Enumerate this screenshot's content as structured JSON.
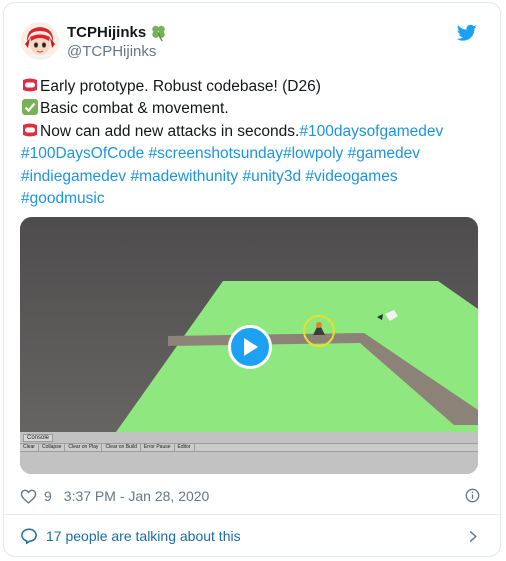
{
  "author": {
    "display_name": "TCPHijinks",
    "handle": "@TCPHijinks",
    "avatar_icon": "anime-character-avatar",
    "badge_icon": "four-leaf-clover-icon"
  },
  "tweet": {
    "lines": [
      {
        "emoji": "name-badge-emoji",
        "segments": [
          {
            "text": "Early prototype. Robust codebase! (D26)",
            "hashtag": false
          }
        ]
      },
      {
        "emoji": "check-mark-emoji",
        "segments": [
          {
            "text": "Basic combat & movement.",
            "hashtag": false
          }
        ]
      },
      {
        "emoji": "name-badge-emoji",
        "segments": [
          {
            "text": "Now can add new attacks in seconds.",
            "hashtag": false
          },
          {
            "text": "#100daysofgamedev",
            "hashtag": true
          }
        ]
      },
      {
        "emoji": "",
        "segments": [
          {
            "text": "#100DaysOfCode",
            "hashtag": true
          },
          {
            "text": " ",
            "hashtag": false
          },
          {
            "text": "#screenshotsunday",
            "hashtag": true
          },
          {
            "text": "#lowpoly",
            "hashtag": true
          },
          {
            "text": " ",
            "hashtag": false
          },
          {
            "text": "#gamedev",
            "hashtag": true
          }
        ]
      },
      {
        "emoji": "",
        "segments": [
          {
            "text": "#indiegamedev",
            "hashtag": true
          },
          {
            "text": " ",
            "hashtag": false
          },
          {
            "text": "#madewithunity",
            "hashtag": true
          },
          {
            "text": " ",
            "hashtag": false
          },
          {
            "text": "#unity3d",
            "hashtag": true
          },
          {
            "text": " ",
            "hashtag": false
          },
          {
            "text": "#videogames",
            "hashtag": true
          }
        ]
      },
      {
        "emoji": "",
        "segments": [
          {
            "text": "#goodmusic",
            "hashtag": true
          }
        ]
      }
    ]
  },
  "media": {
    "type": "video",
    "play_icon": "play-icon",
    "console": {
      "title": "Console",
      "buttons": [
        "Clear",
        "Collapse",
        "Clear on Play",
        "Clear on Build",
        "Error Pause",
        "Editor"
      ]
    }
  },
  "footer": {
    "like_count": "9",
    "timestamp": "3:37 PM - Jan 28, 2020",
    "talking": "17 people are talking about this"
  },
  "colors": {
    "text": "#14171a",
    "secondary": "#657786",
    "hashtag": "#1b95e0",
    "twitter_blue": "#1da1f2",
    "link_dark": "#1b6ba5",
    "ground_green": "#8fe87f",
    "path_tan": "#8c8278"
  }
}
